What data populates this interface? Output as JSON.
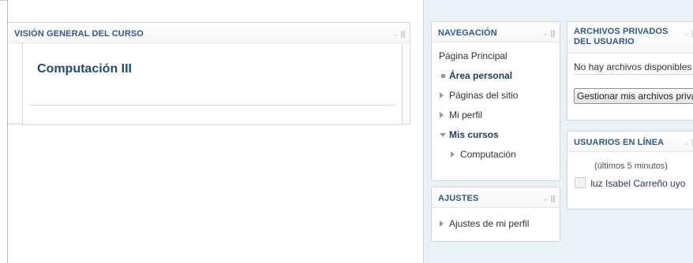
{
  "overview": {
    "title": "VISIÓN GENERAL DEL CURSO",
    "course_name": "Computación III"
  },
  "navigation": {
    "title": "NAVEGACIÓN",
    "items": [
      {
        "label": "Página Principal"
      },
      {
        "label": "Área personal"
      },
      {
        "label": "Páginas del sitio"
      },
      {
        "label": "Mi perfil"
      },
      {
        "label": "Mis cursos"
      },
      {
        "label": "Computación"
      }
    ]
  },
  "settings": {
    "title": "AJUSTES",
    "items": [
      {
        "label": "Ajustes de mi perfil"
      }
    ]
  },
  "private_files": {
    "title": "ARCHIVOS PRIVADOS DEL USUARIO",
    "empty_text": "No hay archivos disponibles",
    "manage_button": "Gestionar mis archivos privados..."
  },
  "online_users": {
    "title": "USUARIOS EN LÍNEA",
    "subtitle": "(últimos 5 minutos)",
    "users": [
      {
        "name": "luz Isabel Carreño uyo"
      }
    ]
  },
  "icons": {
    "block_controls": "collapse-and-dock-icon",
    "nav_bullet": "square-bullet-icon",
    "nav_expand": "triangle-right-icon",
    "nav_collapse": "triangle-down-icon",
    "user_avatar": "avatar-placeholder-icon"
  },
  "colors": {
    "block_title": "#2c5a8c",
    "link_bold": "#1f3d63",
    "sidebar_bg": "#e9f3f7"
  }
}
